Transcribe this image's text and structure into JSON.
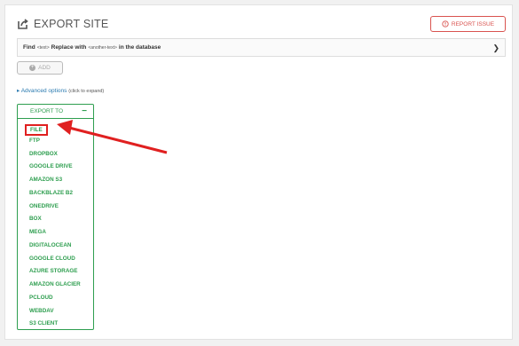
{
  "header": {
    "title": "EXPORT SITE",
    "report_label": "REPORT ISSUE"
  },
  "find_replace": {
    "find_label": "Find",
    "find_placeholder": "<text>",
    "replace_label": "Replace with",
    "replace_placeholder": "<another-text>",
    "suffix": "in the database"
  },
  "add_button": {
    "label": "ADD"
  },
  "advanced": {
    "label": "Advanced options",
    "hint": "(click to expand)"
  },
  "export_to": {
    "heading": "EXPORT TO",
    "options": [
      "FILE",
      "FTP",
      "DROPBOX",
      "GOOGLE DRIVE",
      "AMAZON S3",
      "BACKBLAZE B2",
      "ONEDRIVE",
      "BOX",
      "MEGA",
      "DIGITALOCEAN",
      "GOOGLE CLOUD",
      "AZURE STORAGE",
      "AMAZON GLACIER",
      "PCLOUD",
      "WEBDAV",
      "S3 CLIENT"
    ],
    "selected_index": 0
  },
  "colors": {
    "accent_green": "#2e9e4f",
    "highlight_red": "#e02020",
    "report_red": "#d9534f",
    "link_blue": "#2a7ab0"
  },
  "icons": {
    "title": "export-icon",
    "report": "alert-circle-icon",
    "expand": "chevron-right-icon",
    "add": "plus-circle-icon",
    "collapse": "minus-icon",
    "annotation": "red-arrow-icon"
  }
}
